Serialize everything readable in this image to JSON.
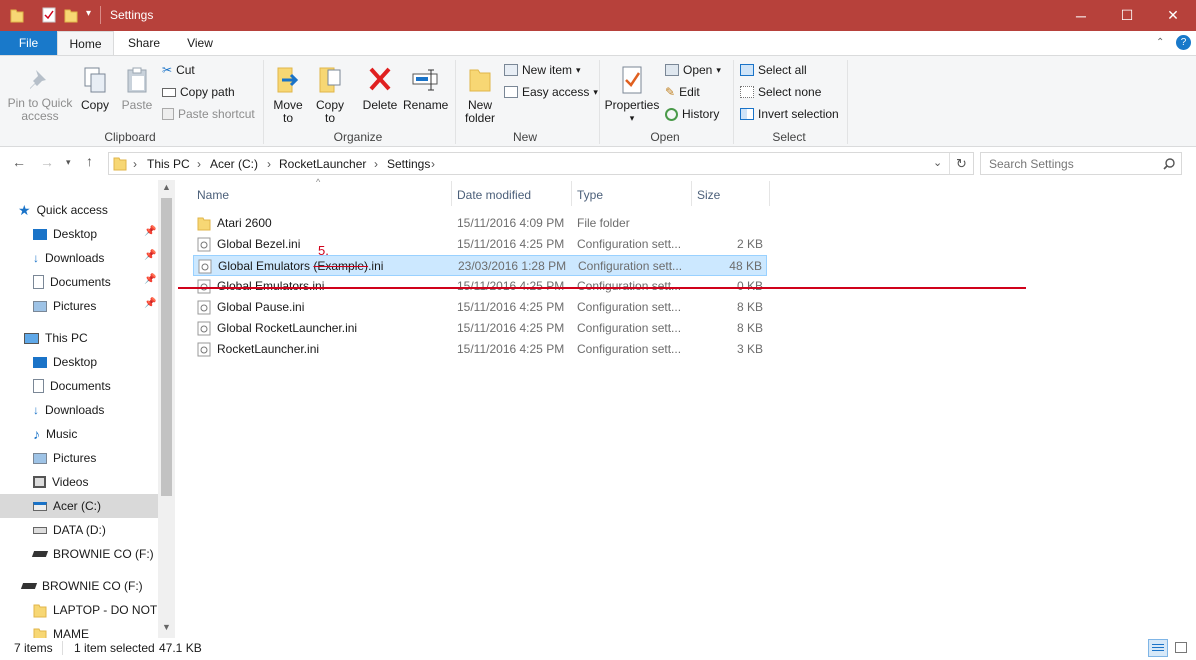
{
  "window": {
    "title": "Settings",
    "controls": {
      "minimize": "─",
      "maximize": "☐",
      "close": "✕"
    }
  },
  "ribbon": {
    "tabs": [
      "File",
      "Home",
      "Share",
      "View"
    ],
    "clipboard": {
      "pin_label": "Pin to Quick access",
      "copy_label": "Copy",
      "paste_label": "Paste",
      "cut_label": "Cut",
      "copy_path_label": "Copy path",
      "paste_shortcut_label": "Paste shortcut",
      "group_label": "Clipboard"
    },
    "organize": {
      "move_label": "Move to",
      "copy_to_label": "Copy to",
      "delete_label": "Delete",
      "rename_label": "Rename",
      "group_label": "Organize"
    },
    "new": {
      "new_folder_label": "New folder",
      "new_item_label": "New item",
      "easy_access_label": "Easy access",
      "group_label": "New"
    },
    "open": {
      "properties_label": "Properties",
      "open_label": "Open",
      "edit_label": "Edit",
      "history_label": "History",
      "group_label": "Open"
    },
    "select": {
      "select_all_label": "Select all",
      "select_none_label": "Select none",
      "invert_label": "Invert selection",
      "group_label": "Select"
    }
  },
  "address": {
    "breadcrumbs": [
      "This PC",
      "Acer (C:)",
      "RocketLauncher",
      "Settings"
    ],
    "search_placeholder": "Search Settings"
  },
  "nav": {
    "quick_access": "Quick access",
    "quick_items": [
      "Desktop",
      "Downloads",
      "Documents",
      "Pictures"
    ],
    "this_pc": "This PC",
    "pc_items": [
      "Desktop",
      "Documents",
      "Downloads",
      "Music",
      "Pictures",
      "Videos",
      "Acer (C:)",
      "DATA (D:)",
      "BROWNIE CO (F:)"
    ],
    "drive_root": "BROWNIE CO (F:)",
    "drive_items": [
      "LAPTOP - DO NOT D",
      "MAME"
    ]
  },
  "columns": {
    "name": "Name",
    "date": "Date modified",
    "type": "Type",
    "size": "Size"
  },
  "files": [
    {
      "name": "Atari 2600",
      "date": "15/11/2016 4:09 PM",
      "type": "File folder",
      "size": "",
      "kind": "folder"
    },
    {
      "name": "Global Bezel.ini",
      "date": "15/11/2016 4:25 PM",
      "type": "Configuration sett...",
      "size": "2 KB",
      "kind": "ini"
    },
    {
      "name": "Global Emulators (Example).ini",
      "name_a": "Global Emulators ",
      "name_b": "(Example)",
      "name_c": ".ini",
      "date": "23/03/2016 1:28 PM",
      "type": "Configuration sett...",
      "size": "48 KB",
      "kind": "ini"
    },
    {
      "name": "Global Emulators.ini",
      "date": "15/11/2016 4:25 PM",
      "type": "Configuration sett...",
      "size": "0 KB",
      "kind": "ini"
    },
    {
      "name": "Global Pause.ini",
      "date": "15/11/2016 4:25 PM",
      "type": "Configuration sett...",
      "size": "8 KB",
      "kind": "ini"
    },
    {
      "name": "Global RocketLauncher.ini",
      "date": "15/11/2016 4:25 PM",
      "type": "Configuration sett...",
      "size": "8 KB",
      "kind": "ini"
    },
    {
      "name": "RocketLauncher.ini",
      "date": "15/11/2016 4:25 PM",
      "type": "Configuration sett...",
      "size": "3 KB",
      "kind": "ini"
    }
  ],
  "annotation": {
    "step_label": "5.",
    "color": "#d0021b"
  },
  "status": {
    "item_count": "7 items",
    "selection": "1 item selected",
    "selection_size": "47.1 KB"
  },
  "colors": {
    "titlebar": "#b7413b",
    "file_tab": "#1979ca",
    "selection": "#cce8ff"
  }
}
